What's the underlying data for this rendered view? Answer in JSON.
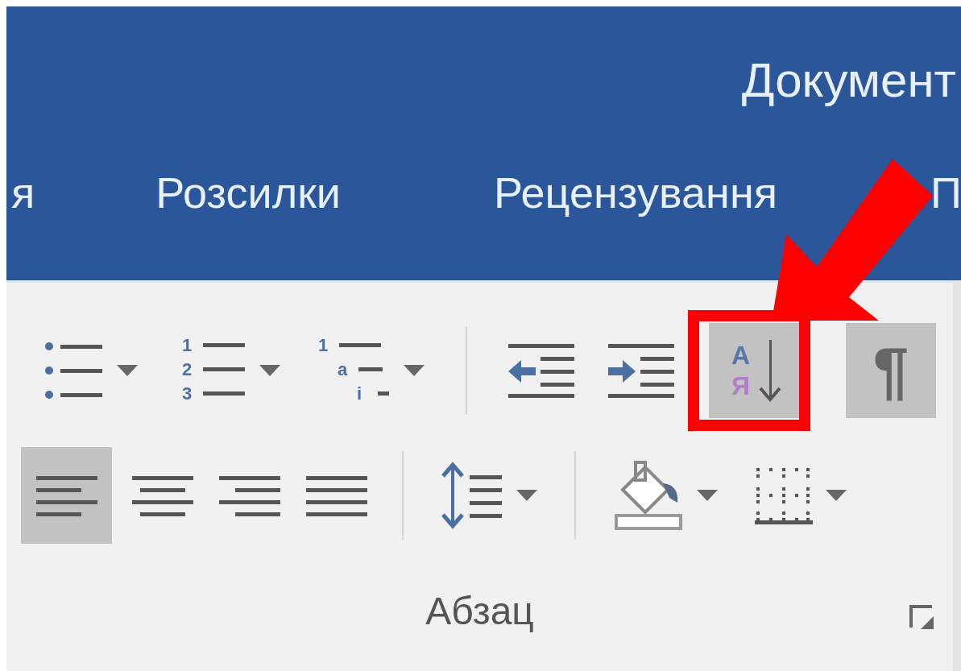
{
  "window": {
    "title": "Документ"
  },
  "tabs": [
    {
      "label": "я"
    },
    {
      "label": "Розсилки"
    },
    {
      "label": "Рецензування"
    },
    {
      "label": "П"
    }
  ],
  "paragraph_group": {
    "label": "Абзац",
    "row_1": [
      {
        "kind": "bullets",
        "dropdown": true,
        "selected": false
      },
      {
        "kind": "numbering",
        "markers": [
          "1",
          "2",
          "3"
        ],
        "dropdown": true,
        "selected": false
      },
      {
        "kind": "multilevel",
        "markers": [
          "1",
          "a",
          "i"
        ],
        "dropdown": true,
        "selected": false
      },
      {
        "kind": "separator"
      },
      {
        "kind": "outdent",
        "selected": false
      },
      {
        "kind": "indent",
        "selected": false
      },
      {
        "kind": "sort",
        "markers": [
          "А",
          "Я"
        ],
        "selected": true,
        "highlighted": true
      },
      {
        "kind": "show_marks",
        "markers": [
          "¶"
        ],
        "selected": true
      }
    ],
    "row_2": [
      {
        "kind": "align_left",
        "selected": true
      },
      {
        "kind": "align_center",
        "selected": false
      },
      {
        "kind": "align_right",
        "selected": false
      },
      {
        "kind": "justify",
        "selected": false
      },
      {
        "kind": "separator"
      },
      {
        "kind": "line_spacing",
        "dropdown": true,
        "selected": false
      },
      {
        "kind": "separator"
      },
      {
        "kind": "shading",
        "dropdown": true,
        "selected": false
      },
      {
        "kind": "borders",
        "dropdown": true,
        "selected": false
      }
    ]
  }
}
